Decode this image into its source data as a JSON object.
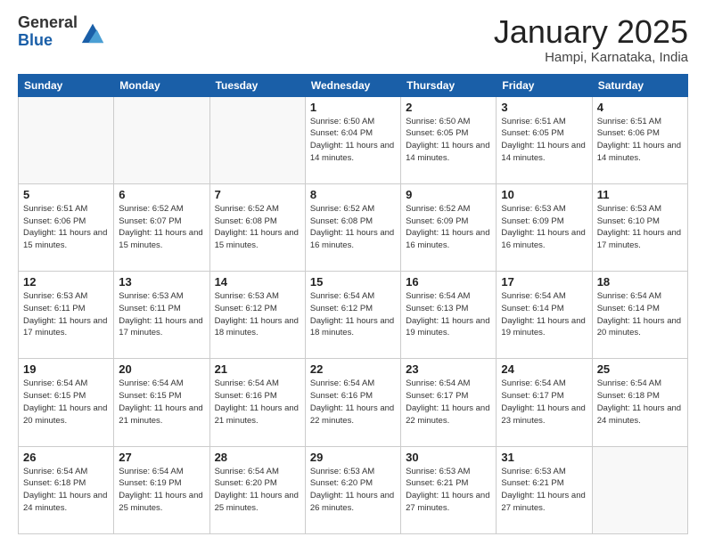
{
  "logo": {
    "general": "General",
    "blue": "Blue"
  },
  "header": {
    "month": "January 2025",
    "location": "Hampi, Karnataka, India"
  },
  "weekdays": [
    "Sunday",
    "Monday",
    "Tuesday",
    "Wednesday",
    "Thursday",
    "Friday",
    "Saturday"
  ],
  "weeks": [
    [
      {
        "day": "",
        "empty": true
      },
      {
        "day": "",
        "empty": true
      },
      {
        "day": "",
        "empty": true
      },
      {
        "day": "1",
        "sunrise": "6:50 AM",
        "sunset": "6:04 PM",
        "daylight": "11 hours and 14 minutes."
      },
      {
        "day": "2",
        "sunrise": "6:50 AM",
        "sunset": "6:05 PM",
        "daylight": "11 hours and 14 minutes."
      },
      {
        "day": "3",
        "sunrise": "6:51 AM",
        "sunset": "6:05 PM",
        "daylight": "11 hours and 14 minutes."
      },
      {
        "day": "4",
        "sunrise": "6:51 AM",
        "sunset": "6:06 PM",
        "daylight": "11 hours and 14 minutes."
      }
    ],
    [
      {
        "day": "5",
        "sunrise": "6:51 AM",
        "sunset": "6:06 PM",
        "daylight": "11 hours and 15 minutes."
      },
      {
        "day": "6",
        "sunrise": "6:52 AM",
        "sunset": "6:07 PM",
        "daylight": "11 hours and 15 minutes."
      },
      {
        "day": "7",
        "sunrise": "6:52 AM",
        "sunset": "6:08 PM",
        "daylight": "11 hours and 15 minutes."
      },
      {
        "day": "8",
        "sunrise": "6:52 AM",
        "sunset": "6:08 PM",
        "daylight": "11 hours and 16 minutes."
      },
      {
        "day": "9",
        "sunrise": "6:52 AM",
        "sunset": "6:09 PM",
        "daylight": "11 hours and 16 minutes."
      },
      {
        "day": "10",
        "sunrise": "6:53 AM",
        "sunset": "6:09 PM",
        "daylight": "11 hours and 16 minutes."
      },
      {
        "day": "11",
        "sunrise": "6:53 AM",
        "sunset": "6:10 PM",
        "daylight": "11 hours and 17 minutes."
      }
    ],
    [
      {
        "day": "12",
        "sunrise": "6:53 AM",
        "sunset": "6:11 PM",
        "daylight": "11 hours and 17 minutes."
      },
      {
        "day": "13",
        "sunrise": "6:53 AM",
        "sunset": "6:11 PM",
        "daylight": "11 hours and 17 minutes."
      },
      {
        "day": "14",
        "sunrise": "6:53 AM",
        "sunset": "6:12 PM",
        "daylight": "11 hours and 18 minutes."
      },
      {
        "day": "15",
        "sunrise": "6:54 AM",
        "sunset": "6:12 PM",
        "daylight": "11 hours and 18 minutes."
      },
      {
        "day": "16",
        "sunrise": "6:54 AM",
        "sunset": "6:13 PM",
        "daylight": "11 hours and 19 minutes."
      },
      {
        "day": "17",
        "sunrise": "6:54 AM",
        "sunset": "6:14 PM",
        "daylight": "11 hours and 19 minutes."
      },
      {
        "day": "18",
        "sunrise": "6:54 AM",
        "sunset": "6:14 PM",
        "daylight": "11 hours and 20 minutes."
      }
    ],
    [
      {
        "day": "19",
        "sunrise": "6:54 AM",
        "sunset": "6:15 PM",
        "daylight": "11 hours and 20 minutes."
      },
      {
        "day": "20",
        "sunrise": "6:54 AM",
        "sunset": "6:15 PM",
        "daylight": "11 hours and 21 minutes."
      },
      {
        "day": "21",
        "sunrise": "6:54 AM",
        "sunset": "6:16 PM",
        "daylight": "11 hours and 21 minutes."
      },
      {
        "day": "22",
        "sunrise": "6:54 AM",
        "sunset": "6:16 PM",
        "daylight": "11 hours and 22 minutes."
      },
      {
        "day": "23",
        "sunrise": "6:54 AM",
        "sunset": "6:17 PM",
        "daylight": "11 hours and 22 minutes."
      },
      {
        "day": "24",
        "sunrise": "6:54 AM",
        "sunset": "6:17 PM",
        "daylight": "11 hours and 23 minutes."
      },
      {
        "day": "25",
        "sunrise": "6:54 AM",
        "sunset": "6:18 PM",
        "daylight": "11 hours and 24 minutes."
      }
    ],
    [
      {
        "day": "26",
        "sunrise": "6:54 AM",
        "sunset": "6:18 PM",
        "daylight": "11 hours and 24 minutes."
      },
      {
        "day": "27",
        "sunrise": "6:54 AM",
        "sunset": "6:19 PM",
        "daylight": "11 hours and 25 minutes."
      },
      {
        "day": "28",
        "sunrise": "6:54 AM",
        "sunset": "6:20 PM",
        "daylight": "11 hours and 25 minutes."
      },
      {
        "day": "29",
        "sunrise": "6:53 AM",
        "sunset": "6:20 PM",
        "daylight": "11 hours and 26 minutes."
      },
      {
        "day": "30",
        "sunrise": "6:53 AM",
        "sunset": "6:21 PM",
        "daylight": "11 hours and 27 minutes."
      },
      {
        "day": "31",
        "sunrise": "6:53 AM",
        "sunset": "6:21 PM",
        "daylight": "11 hours and 27 minutes."
      },
      {
        "day": "",
        "empty": true
      }
    ]
  ]
}
